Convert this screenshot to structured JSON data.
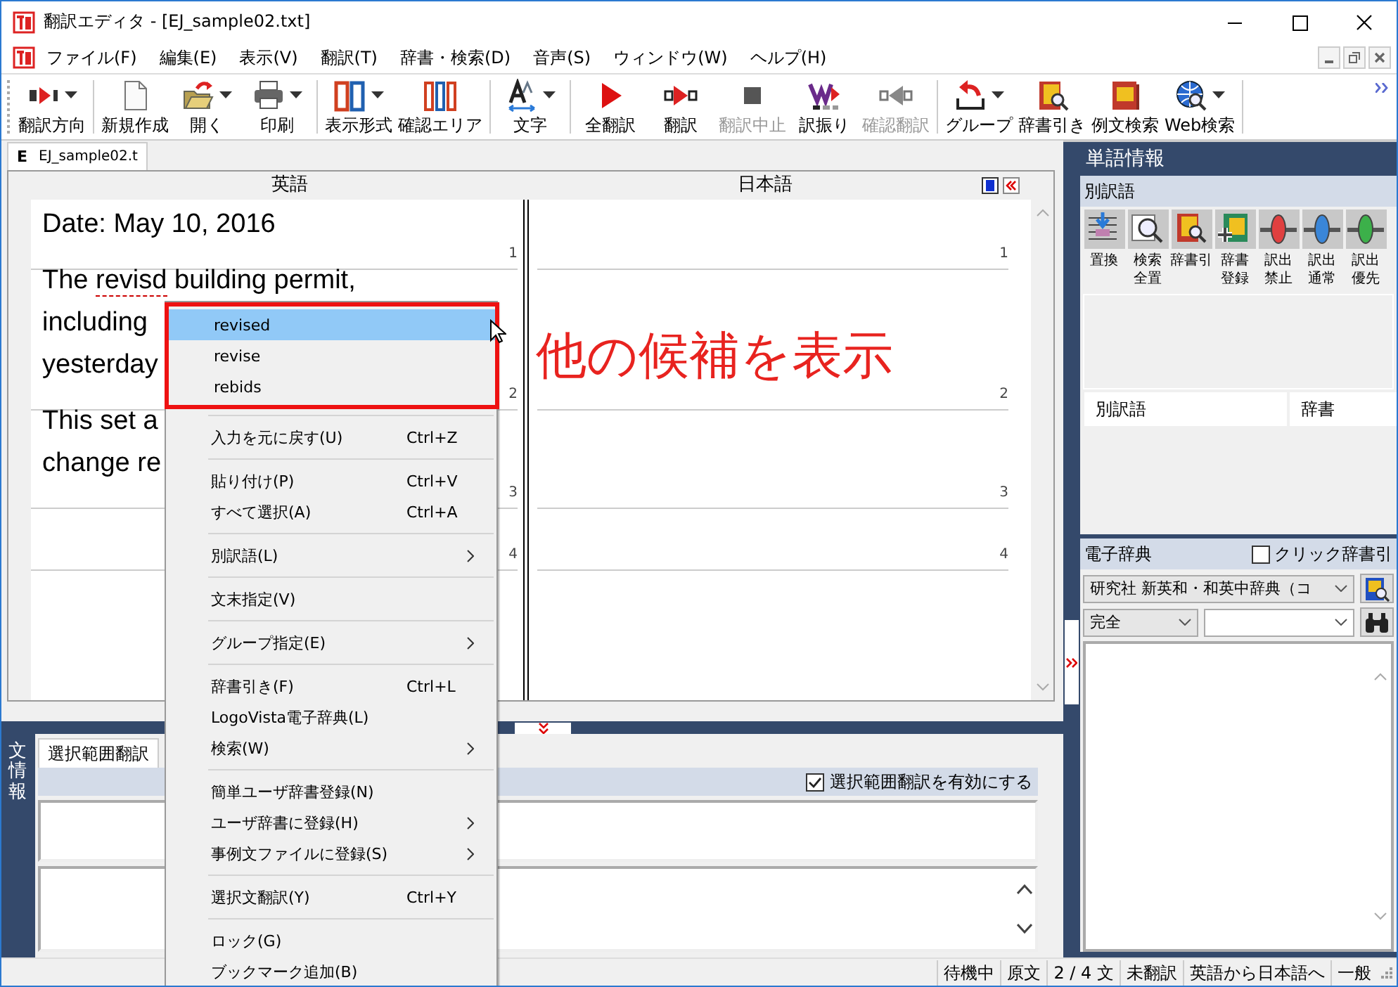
{
  "window": {
    "title": "翻訳エディタ - [EJ_sample02.txt]"
  },
  "menu_bar": [
    "ファイル(F)",
    "編集(E)",
    "表示(V)",
    "翻訳(T)",
    "辞書・検索(D)",
    "音声(S)",
    "ウィンドウ(W)",
    "ヘルプ(H)"
  ],
  "toolbar": [
    [
      {
        "label": "翻訳方向",
        "kind": "direction",
        "dropdown": true,
        "disabled": false
      }
    ],
    [
      {
        "label": "新規作成",
        "kind": "new",
        "dropdown": false,
        "disabled": false
      },
      {
        "label": "開く",
        "kind": "open",
        "dropdown": true,
        "disabled": false
      },
      {
        "label": "印刷",
        "kind": "print",
        "dropdown": true,
        "disabled": false
      }
    ],
    [
      {
        "label": "表示形式",
        "kind": "layout",
        "dropdown": true,
        "disabled": false
      },
      {
        "label": "確認エリア",
        "kind": "area",
        "dropdown": false,
        "disabled": false
      }
    ],
    [
      {
        "label": "文字",
        "kind": "font",
        "dropdown": true,
        "disabled": false
      }
    ],
    [
      {
        "label": "全翻訳",
        "kind": "play",
        "dropdown": false,
        "disabled": false
      },
      {
        "label": "翻訳",
        "kind": "translate",
        "dropdown": false,
        "disabled": false
      },
      {
        "label": "翻訳中止",
        "kind": "stop",
        "dropdown": false,
        "disabled": true
      },
      {
        "label": "訳振り",
        "kind": "assign",
        "dropdown": false,
        "disabled": false
      },
      {
        "label": "確認翻訳",
        "kind": "reverse",
        "dropdown": false,
        "disabled": true
      }
    ],
    [
      {
        "label": "グループ",
        "kind": "group",
        "dropdown": true,
        "disabled": false
      },
      {
        "label": "辞書引き",
        "kind": "dictionary",
        "dropdown": false,
        "disabled": false
      },
      {
        "label": "例文検索",
        "kind": "example",
        "dropdown": false,
        "disabled": false
      },
      {
        "label": "Web検索",
        "kind": "web",
        "dropdown": true,
        "disabled": false
      }
    ]
  ],
  "document_tab": {
    "mode": "E",
    "label": "EJ_sample02.t"
  },
  "editor": {
    "columns": [
      "英語",
      "日本語"
    ],
    "rows": [
      {
        "source_lines": [
          [
            {
              "kind": "plain",
              "text": "Date: May 10, 2016"
            }
          ]
        ],
        "source_number": "1",
        "target_number": "1"
      },
      {
        "source_lines": [
          [
            {
              "kind": "plain",
              "text": "The "
            },
            {
              "kind": "misspelled",
              "text": "revisd"
            },
            {
              "kind": "plain",
              "text": " building permit,"
            }
          ],
          [
            {
              "kind": "plain",
              "text": "including"
            }
          ],
          [
            {
              "kind": "plain",
              "text": "yesterday"
            }
          ]
        ],
        "source_number": "2",
        "target_number": "2"
      },
      {
        "source_lines": [
          [
            {
              "kind": "plain",
              "text": "This set a"
            }
          ],
          [
            {
              "kind": "plain",
              "text": "change re"
            }
          ]
        ],
        "source_number": "3",
        "target_number": "3"
      },
      {
        "source_lines": [],
        "source_number": "4",
        "target_number": "4"
      }
    ]
  },
  "context_menu": {
    "candidates": [
      {
        "label": "revised",
        "selected": true
      },
      {
        "label": "revise",
        "selected": false
      },
      {
        "label": "rebids",
        "selected": false
      }
    ],
    "groups": [
      [
        {
          "label": "入力を元に戻す(U)",
          "shortcut": "Ctrl+Z",
          "submenu": false
        }
      ],
      [
        {
          "label": "貼り付け(P)",
          "shortcut": "Ctrl+V",
          "submenu": false
        },
        {
          "label": "すべて選択(A)",
          "shortcut": "Ctrl+A",
          "submenu": false
        }
      ],
      [
        {
          "label": "別訳語(L)",
          "submenu": true
        }
      ],
      [
        {
          "label": "文末指定(V)",
          "submenu": false
        }
      ],
      [
        {
          "label": "グループ指定(E)",
          "submenu": true
        }
      ],
      [
        {
          "label": "辞書引き(F)",
          "shortcut": "Ctrl+L",
          "submenu": false
        },
        {
          "label": "LogoVista電子辞典(L)",
          "submenu": false
        },
        {
          "label": "検索(W)",
          "submenu": true
        }
      ],
      [
        {
          "label": "簡単ユーザ辞書登録(N)",
          "submenu": false
        },
        {
          "label": "ユーザ辞書に登録(H)",
          "submenu": true
        },
        {
          "label": "事例文ファイルに登録(S)",
          "submenu": true
        }
      ],
      [
        {
          "label": "選択文翻訳(Y)",
          "shortcut": "Ctrl+Y",
          "submenu": false
        }
      ],
      [
        {
          "label": "ロック(G)",
          "submenu": false
        },
        {
          "label": "ブックマーク追加(B)",
          "submenu": false
        }
      ]
    ]
  },
  "annotation": {
    "text": "他の候補を表示"
  },
  "sentence_info": {
    "title": "文情報",
    "tabs": [
      {
        "label": "選択範囲翻訳",
        "selected": true
      }
    ],
    "enable_checkbox": {
      "label": "選択範囲翻訳を有効にする",
      "checked": true
    }
  },
  "word_info": {
    "title": "単語情報",
    "alternatives": {
      "title": "別訳語",
      "tools": [
        {
          "label": "置換",
          "kind": "replace"
        },
        {
          "label": "検索全置",
          "kind": "search"
        },
        {
          "label": "辞書引",
          "kind": "dictionary"
        },
        {
          "label": "辞書登録",
          "kind": "register"
        },
        {
          "label": "訳出禁止",
          "kind": "slider",
          "color": "#e04040"
        },
        {
          "label": "訳出通常",
          "kind": "slider",
          "color": "#3a86d8"
        },
        {
          "label": "訳出優先",
          "kind": "slider",
          "color": "#3cb04a"
        }
      ],
      "columns": [
        "別訳語",
        "辞書"
      ]
    },
    "dictionary": {
      "title": "電子辞典",
      "click_lookup": {
        "label": "クリック辞書引",
        "checked": false
      },
      "dictionary_select": "研究社 新英和・和英中辞典（コ",
      "match_select": "完全"
    }
  },
  "status_bar": [
    "待機中",
    "原文",
    "2 / 4 文",
    "未翻訳",
    "英語から日本語へ",
    "一般"
  ]
}
